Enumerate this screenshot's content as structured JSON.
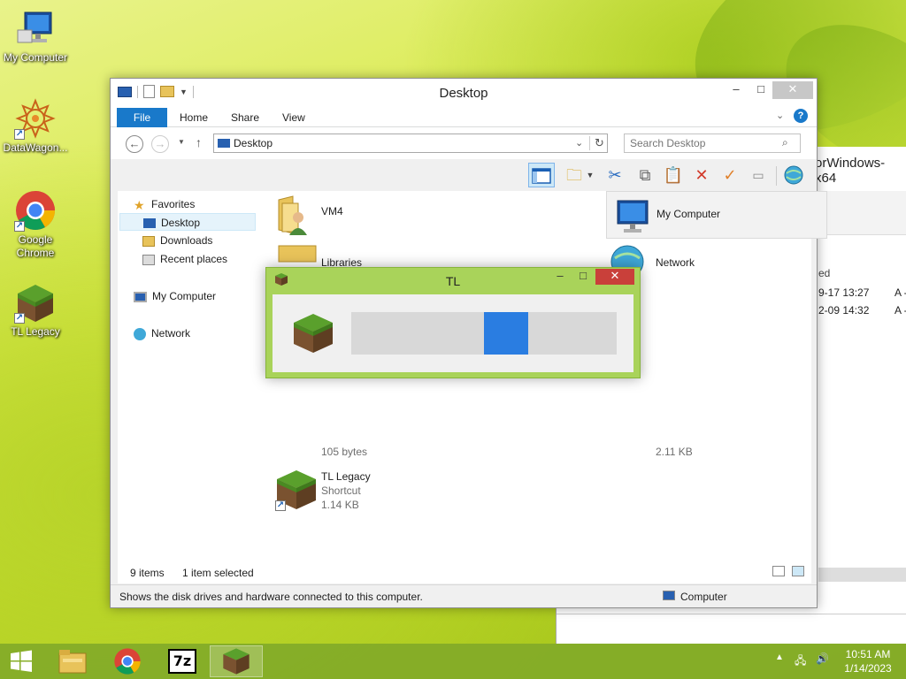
{
  "colors": {
    "accent": "#1979ca",
    "dialog_frame": "#a9d35a",
    "progress": "#2a7de1",
    "close_red": "#c9403a",
    "taskbar": "#82aa28"
  },
  "desktop": {
    "icons": [
      {
        "label": "My Computer",
        "icon": "computer-icon"
      },
      {
        "label": "DataWagon...",
        "icon": "datawagon-icon"
      },
      {
        "label": "Google Chrome",
        "icon": "chrome-icon"
      },
      {
        "label": "TL Legacy",
        "icon": "grass-block-icon"
      }
    ]
  },
  "background_window": {
    "title": "orWindows-x64",
    "column_header": "ed",
    "rows": [
      {
        "modified": "9-17 13:27",
        "attr": "A -"
      },
      {
        "modified": "2-09 14:32",
        "attr": "A -"
      }
    ]
  },
  "explorer": {
    "title": "Desktop",
    "tabs": {
      "file": "File",
      "home": "Home",
      "share": "Share",
      "view": "View"
    },
    "address": "Desktop",
    "search_placeholder": "Search Desktop",
    "nav": {
      "favorites": "Favorites",
      "desktop": "Desktop",
      "downloads": "Downloads",
      "recent": "Recent places",
      "my_computer": "My Computer",
      "network": "Network"
    },
    "items": {
      "vm4": {
        "name": "VM4"
      },
      "my_computer": {
        "name": "My Computer"
      },
      "libraries": {
        "name": "Libraries"
      },
      "network": {
        "name": "Network"
      },
      "hidden_size_left": "105 bytes",
      "hidden_size_right": "2.11 KB",
      "tl_legacy": {
        "name": "TL Legacy",
        "type": "Shortcut",
        "size": "1.14 KB"
      }
    },
    "status": {
      "count": "9 items",
      "selected": "1 item selected"
    },
    "info": {
      "message": "Shows the disk drives and hardware connected to this computer.",
      "location": "Computer"
    }
  },
  "tl_dialog": {
    "title": "TL",
    "progress": {
      "mode": "marquee",
      "position_fraction": 0.5
    }
  },
  "taskbar": {
    "buttons": [
      "start-icon",
      "file-explorer-icon",
      "chrome-icon",
      "7zip-icon",
      "grass-block-icon"
    ],
    "clock": {
      "time": "10:51 AM",
      "date": "1/14/2023"
    }
  }
}
